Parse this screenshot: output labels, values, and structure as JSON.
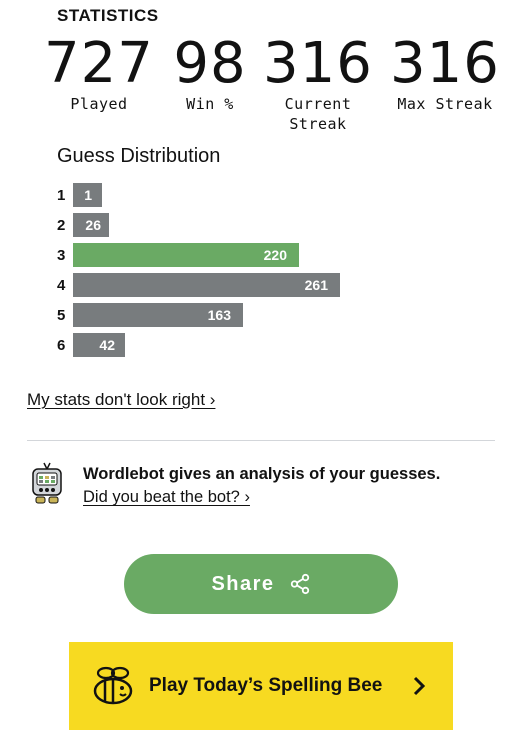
{
  "stats": {
    "title": "STATISTICS",
    "items": [
      {
        "value": "727",
        "label": "Played"
      },
      {
        "value": "98",
        "label": "Win %"
      },
      {
        "value": "316",
        "label": "Current Streak"
      },
      {
        "value": "316",
        "label": "Max Streak"
      }
    ]
  },
  "distribution": {
    "heading": "Guess Distribution",
    "rows": [
      {
        "guess": "1",
        "count": "1"
      },
      {
        "guess": "2",
        "count": "26"
      },
      {
        "guess": "3",
        "count": "220"
      },
      {
        "guess": "4",
        "count": "261"
      },
      {
        "guess": "5",
        "count": "163"
      },
      {
        "guess": "6",
        "count": "42"
      }
    ],
    "highlight_color": "#6aaa64",
    "bar_color": "#787c7e"
  },
  "links": {
    "stats_wrong": "My stats don't look right ›"
  },
  "wordlebot": {
    "title": "Wordlebot gives an analysis of your guesses.",
    "link": "Did you beat the bot? ›",
    "icon": "wordlebot-icon"
  },
  "share": {
    "label": "Share",
    "icon": "share-icon",
    "color": "#6aaa64"
  },
  "spelling_bee": {
    "label": "Play Today’s Spelling Bee",
    "icon": "bee-icon",
    "color": "#f7da21"
  }
}
